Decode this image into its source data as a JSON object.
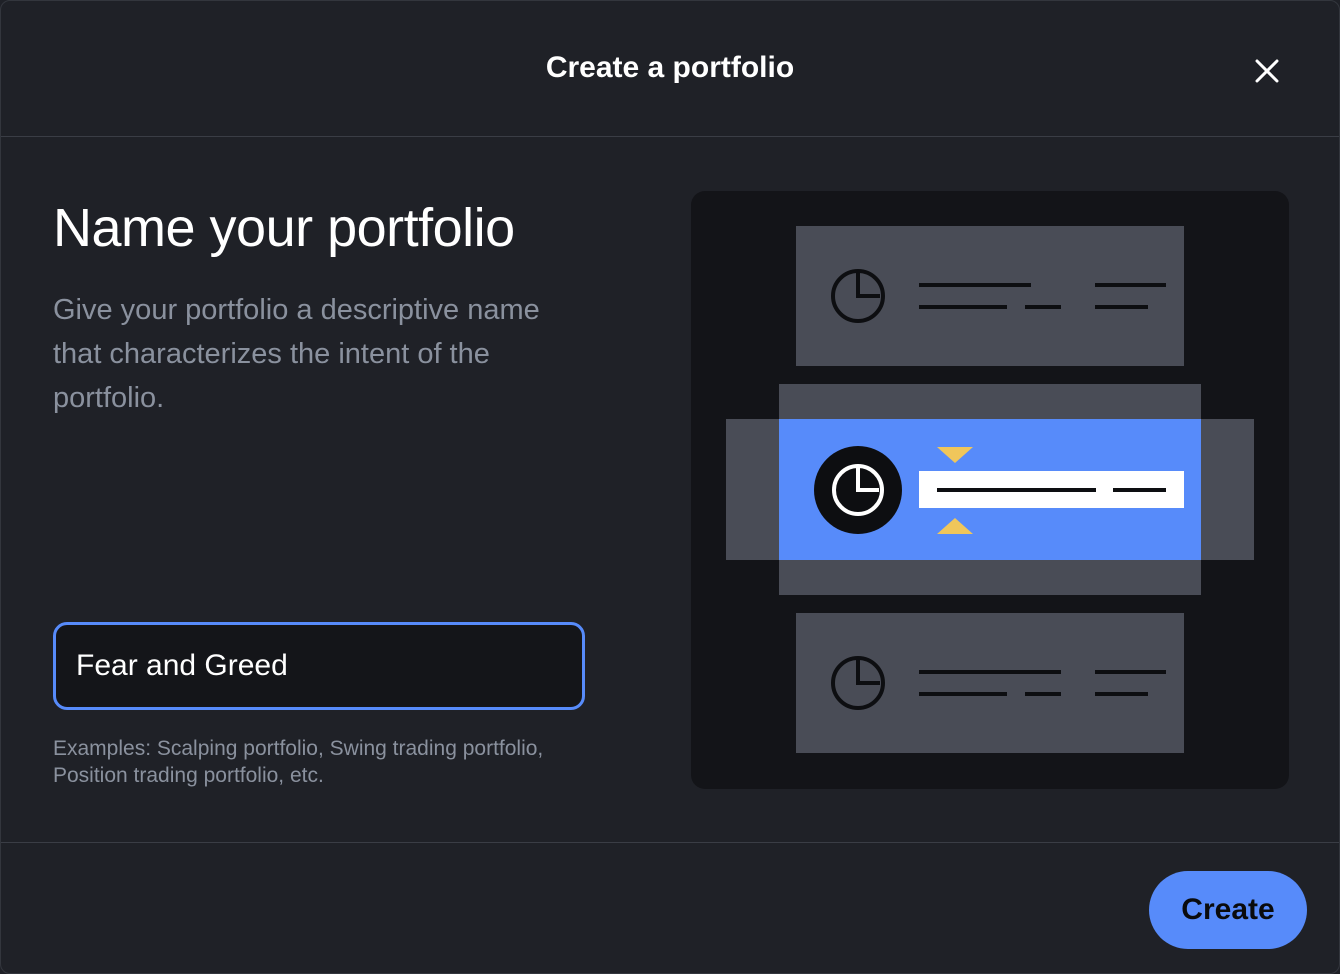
{
  "dialog": {
    "title": "Create a portfolio",
    "close_icon": "close-icon"
  },
  "content": {
    "heading": "Name your portfolio",
    "description": "Give your portfolio a descriptive name that characterizes the intent of the portfolio.",
    "input_value": "Fear and Greed",
    "hint": "Examples: Scalping portfolio, Swing trading portfolio, Position trading portfolio, etc."
  },
  "illustration": {
    "icons": [
      "pie-chart-icon",
      "pie-chart-icon",
      "pie-chart-icon",
      "triangle-icon"
    ],
    "colors": {
      "panel": "#131418",
      "card": "#494c56",
      "highlight": "#578bfa",
      "accent": "#f0c65b"
    }
  },
  "footer": {
    "create_label": "Create"
  },
  "colors": {
    "background": "#1f2127",
    "primary": "#578bfa",
    "muted_text": "#8a919e"
  }
}
